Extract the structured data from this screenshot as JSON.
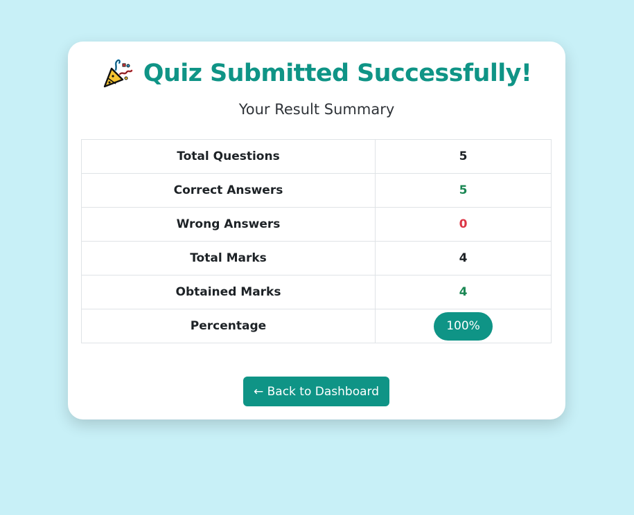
{
  "header": {
    "title": "Quiz Submitted Successfully!",
    "icon": "party-popper-icon",
    "subtitle": "Your Result Summary"
  },
  "summary": {
    "rows": [
      {
        "label": "Total Questions",
        "value": "5",
        "color": "#1d2226"
      },
      {
        "label": "Correct Answers",
        "value": "5",
        "color": "#1a8754"
      },
      {
        "label": "Wrong Answers",
        "value": "0",
        "color": "#dc3545"
      },
      {
        "label": "Total Marks",
        "value": "4",
        "color": "#1d2226"
      },
      {
        "label": "Obtained Marks",
        "value": "4",
        "color": "#1a8754"
      },
      {
        "label": "Percentage",
        "value": "100%",
        "color": "#ffffff"
      }
    ]
  },
  "actions": {
    "back_label": "← Back to Dashboard"
  },
  "colors": {
    "page_background": "#c8f0f7",
    "accent": "#0f9486",
    "success": "#1a8754",
    "danger": "#dc3545"
  }
}
